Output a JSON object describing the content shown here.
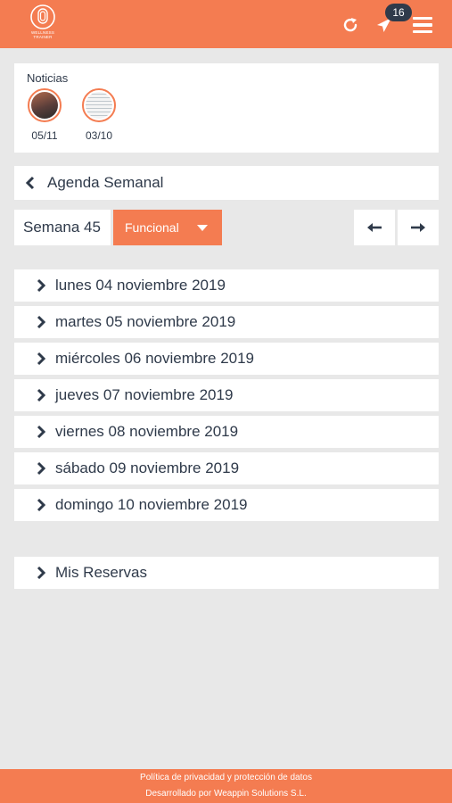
{
  "header": {
    "logo_line1": "WELLNESS",
    "logo_line2": "TRAINER",
    "notification_count": "16",
    "brand_color": "#f47c51",
    "icons": [
      "refresh-icon",
      "paper-plane-icon",
      "hamburger-menu-icon"
    ]
  },
  "news": {
    "title": "Noticias",
    "items": [
      {
        "date": "05/11"
      },
      {
        "date": "03/10"
      }
    ]
  },
  "agenda": {
    "title": "Agenda Semanal",
    "week_label": "Semana 45",
    "filter_label": "Funcional",
    "days": [
      {
        "label": "lunes 04 noviembre 2019"
      },
      {
        "label": "martes 05 noviembre 2019"
      },
      {
        "label": "miércoles 06 noviembre 2019"
      },
      {
        "label": "jueves 07 noviembre 2019"
      },
      {
        "label": "viernes 08 noviembre 2019"
      },
      {
        "label": "sábado 09 noviembre 2019"
      },
      {
        "label": "domingo 10 noviembre 2019"
      }
    ]
  },
  "reservas": {
    "label": "Mis Reservas"
  },
  "footer": {
    "privacy_link": "Política de privacidad y protección de datos",
    "credits": "Desarrollado por Weappin Solutions S.L."
  }
}
